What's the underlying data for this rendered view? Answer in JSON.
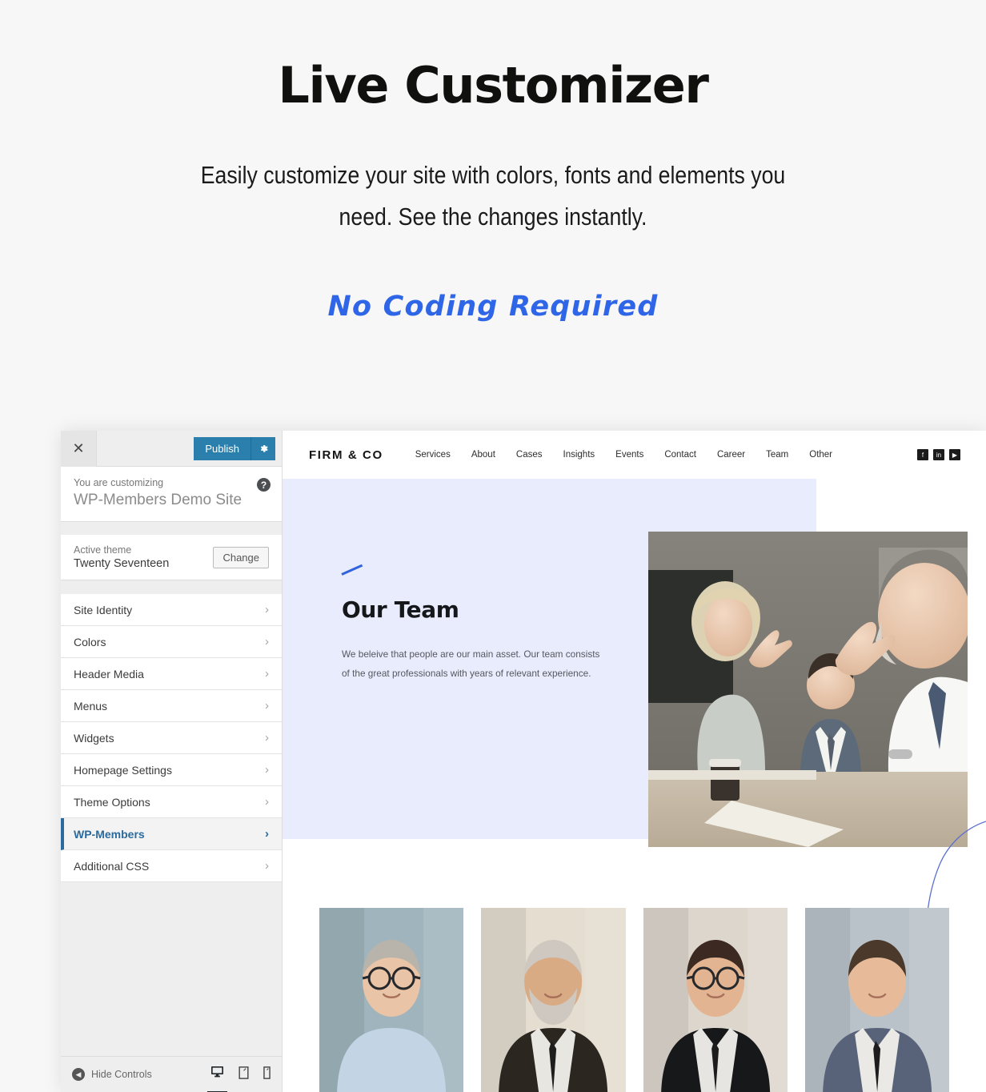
{
  "promo": {
    "title": "Live Customizer",
    "subtitle": "Easily customize your site with colors, fonts and elements you need. See the changes instantly.",
    "script_line": "No Coding Required",
    "script_color": "#2f66e8"
  },
  "customizer": {
    "close_icon": "✕",
    "publish_label": "Publish",
    "gear_icon": "⚙",
    "help_icon": "?",
    "customizing_label": "You are customizing",
    "site_name": "WP-Members Demo Site",
    "active_theme_label": "Active theme",
    "active_theme_name": "Twenty Seventeen",
    "change_label": "Change",
    "accent_color": "#2b7fad",
    "active_item_color": "#2b6a9c",
    "sections": [
      {
        "label": "Site Identity",
        "chevron": "›",
        "active": false
      },
      {
        "label": "Colors",
        "chevron": "›",
        "active": false
      },
      {
        "label": "Header Media",
        "chevron": "›",
        "active": false
      },
      {
        "label": "Menus",
        "chevron": "›",
        "active": false
      },
      {
        "label": "Widgets",
        "chevron": "›",
        "active": false
      },
      {
        "label": "Homepage Settings",
        "chevron": "›",
        "active": false
      },
      {
        "label": "Theme Options",
        "chevron": "›",
        "active": false
      },
      {
        "label": "WP-Members",
        "chevron": "›",
        "active": true
      },
      {
        "label": "Additional CSS",
        "chevron": "›",
        "active": false
      }
    ],
    "footer": {
      "hide_controls_label": "Hide Controls",
      "hide_icon": "◀",
      "devices": [
        {
          "name": "desktop-preview",
          "active": true
        },
        {
          "name": "tablet-preview",
          "active": false
        },
        {
          "name": "mobile-preview",
          "active": false
        }
      ]
    }
  },
  "preview": {
    "logo": "FIRM & CO",
    "nav": [
      "Services",
      "About",
      "Cases",
      "Insights",
      "Events",
      "Contact",
      "Career",
      "Team",
      "Other"
    ],
    "social": [
      {
        "name": "facebook-icon",
        "glyph": "f"
      },
      {
        "name": "linkedin-icon",
        "glyph": "in"
      },
      {
        "name": "youtube-icon",
        "glyph": "▶"
      }
    ],
    "hero": {
      "heading": "Our Team",
      "body": "We beleive that people are our main asset. Our team consists of the great professionals with years of relevant experience.",
      "bg_color": "#e8ecfd",
      "accent_color": "#3163e0",
      "image_alt": "Business team high-fiving across a conference table"
    },
    "team_photos": [
      {
        "alt": "Smiling man with glasses in light blue shirt, arms crossed"
      },
      {
        "alt": "Bearded man in dark suit and tie, arms crossed"
      },
      {
        "alt": "Smiling woman with glasses holding a folder"
      },
      {
        "alt": "Young man in grey-blue suit by a window"
      }
    ]
  }
}
